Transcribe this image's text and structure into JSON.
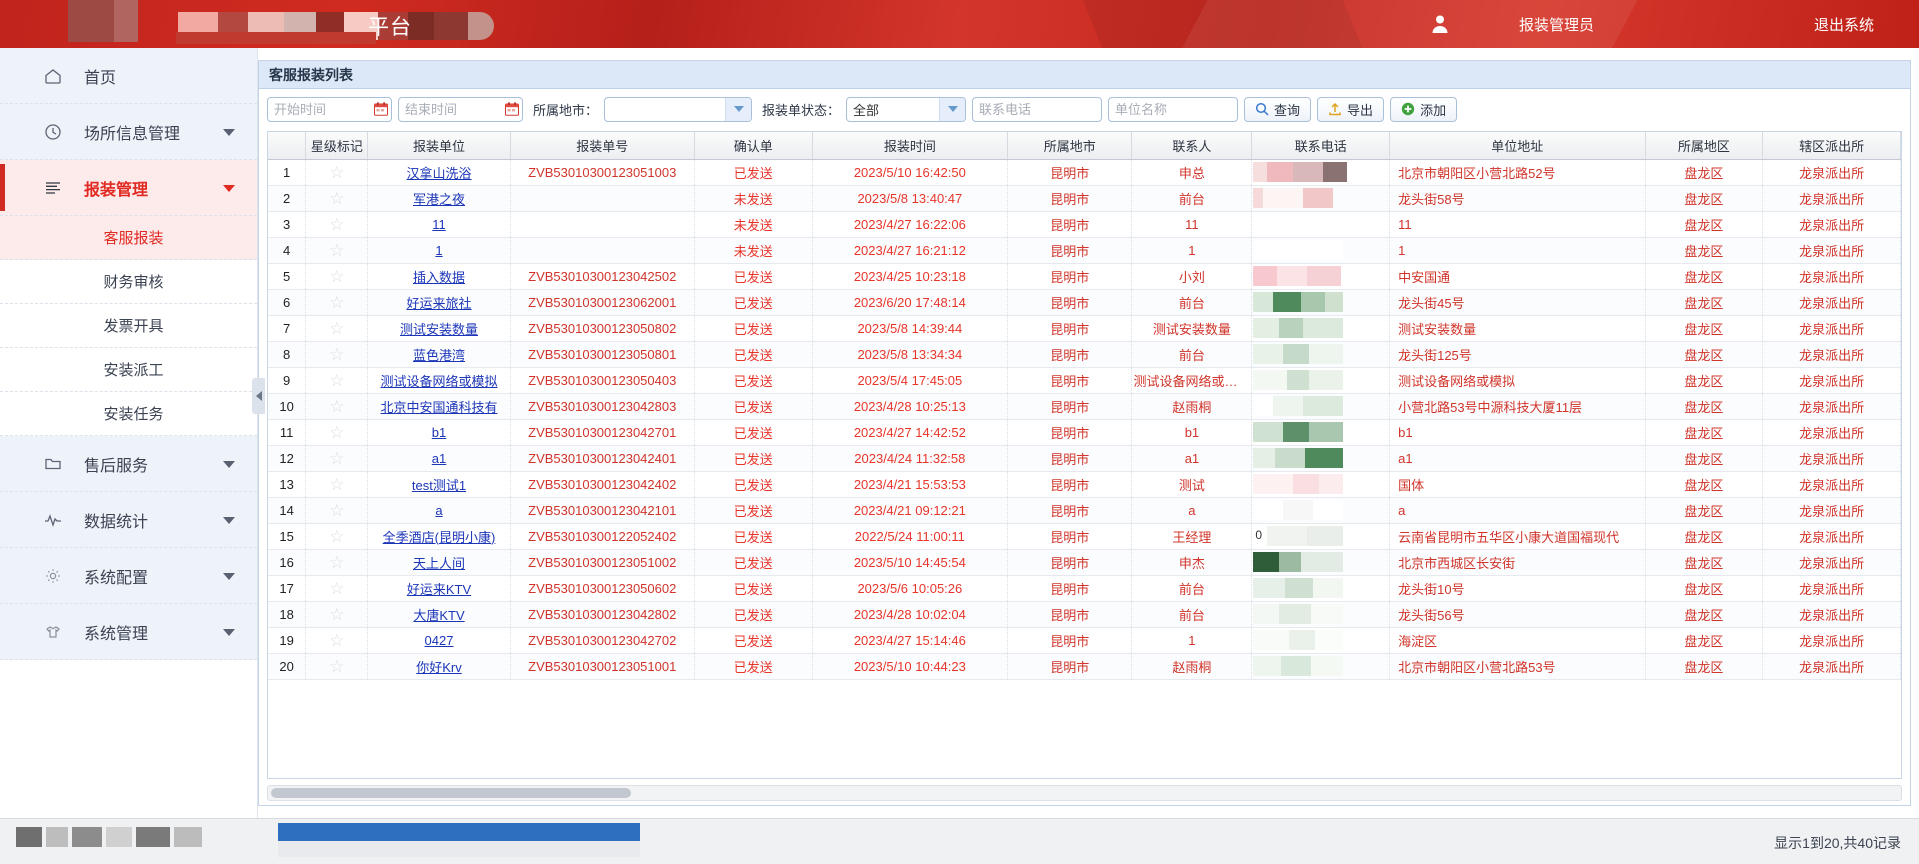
{
  "header": {
    "brand_suffix": "平台",
    "user_icon": "user-icon",
    "username": "报装管理员",
    "logout": "退出系统",
    "accent": "#c62820"
  },
  "sidebar": {
    "items": [
      {
        "label": "首页",
        "icon": "home-icon",
        "caret": false,
        "active": false
      },
      {
        "label": "场所信息管理",
        "icon": "clock-icon",
        "caret": true,
        "active": false
      },
      {
        "label": "报装管理",
        "icon": "list-icon",
        "caret": true,
        "active": true
      },
      {
        "label": "售后服务",
        "icon": "folder-icon",
        "caret": true,
        "active": false
      },
      {
        "label": "数据统计",
        "icon": "pulse-icon",
        "caret": true,
        "active": false
      },
      {
        "label": "系统配置",
        "icon": "gear-icon",
        "caret": true,
        "active": false
      },
      {
        "label": "系统管理",
        "icon": "shirt-icon",
        "caret": true,
        "active": false
      }
    ],
    "sub_items": [
      {
        "label": "客服报装",
        "active": true
      },
      {
        "label": "财务审核",
        "active": false
      },
      {
        "label": "发票开具",
        "active": false
      },
      {
        "label": "安装派工",
        "active": false
      },
      {
        "label": "安装任务",
        "active": false
      }
    ]
  },
  "panel": {
    "title": "客服报装列表"
  },
  "filters": {
    "start_time": {
      "value": "",
      "placeholder": "开始时间",
      "icon": "calendar-icon"
    },
    "end_time": {
      "value": "",
      "placeholder": "结束时间",
      "icon": "calendar-icon"
    },
    "city_label": "所属地市：",
    "city_value": "",
    "status_label": "报装单状态：",
    "status_value": "全部",
    "status_options": [
      "全部"
    ],
    "phone": {
      "value": "",
      "placeholder": "联系电话"
    },
    "unit": {
      "value": "",
      "placeholder": "单位名称"
    },
    "buttons": [
      {
        "label": "查询",
        "icon": "search-icon"
      },
      {
        "label": "导出",
        "icon": "export-icon"
      },
      {
        "label": "添加",
        "icon": "plus-icon"
      }
    ]
  },
  "table": {
    "columns": [
      "",
      "星级标记",
      "报装单位",
      "报装单号",
      "确认单",
      "报装时间",
      "所属地市",
      "联系人",
      "联系电话",
      "单位地址",
      "所属地区",
      "辖区派出所"
    ],
    "rows": [
      {
        "no": "1",
        "unit": "汉拿山洗浴",
        "order": "ZVB53010300123051003",
        "conf": "已发送",
        "time": "2023/5/10 16:42:50",
        "city": "昆明市",
        "contact": "申总",
        "phone": "",
        "addr": "北京市朝阳区小营北路52号",
        "area": "盘龙区",
        "police": "龙泉派出所"
      },
      {
        "no": "2",
        "unit": "军港之夜",
        "order": "",
        "conf": "未发送",
        "time": "2023/5/8 13:40:47",
        "city": "昆明市",
        "contact": "前台",
        "phone": "",
        "addr": "龙头街58号",
        "area": "盘龙区",
        "police": "龙泉派出所"
      },
      {
        "no": "3",
        "unit": "11",
        "order": "",
        "conf": "未发送",
        "time": "2023/4/27 16:22:06",
        "city": "昆明市",
        "contact": "11",
        "phone": "",
        "addr": "11",
        "area": "盘龙区",
        "police": "龙泉派出所"
      },
      {
        "no": "4",
        "unit": "1",
        "order": "",
        "conf": "未发送",
        "time": "2023/4/27 16:21:12",
        "city": "昆明市",
        "contact": "1",
        "phone": "",
        "addr": "1",
        "area": "盘龙区",
        "police": "龙泉派出所"
      },
      {
        "no": "5",
        "unit": "插入数据",
        "order": "ZVB53010300123042502",
        "conf": "已发送",
        "time": "2023/4/25 10:23:18",
        "city": "昆明市",
        "contact": "小刘",
        "phone": "",
        "addr": "中安国通",
        "area": "盘龙区",
        "police": "龙泉派出所"
      },
      {
        "no": "6",
        "unit": "好运来旅社",
        "order": "ZVB53010300123062001",
        "conf": "已发送",
        "time": "2023/6/20 17:48:14",
        "city": "昆明市",
        "contact": "前台",
        "phone": "",
        "addr": "龙头街45号",
        "area": "盘龙区",
        "police": "龙泉派出所"
      },
      {
        "no": "7",
        "unit": "测试安装数量",
        "order": "ZVB53010300123050802",
        "conf": "已发送",
        "time": "2023/5/8 14:39:44",
        "city": "昆明市",
        "contact": "测试安装数量",
        "phone": "",
        "addr": "测试安装数量",
        "area": "盘龙区",
        "police": "龙泉派出所"
      },
      {
        "no": "8",
        "unit": "蓝色港湾",
        "order": "ZVB53010300123050801",
        "conf": "已发送",
        "time": "2023/5/8 13:34:34",
        "city": "昆明市",
        "contact": "前台",
        "phone": "",
        "addr": "龙头街125号",
        "area": "盘龙区",
        "police": "龙泉派出所"
      },
      {
        "no": "9",
        "unit": "测试设备网络或模拟",
        "order": "ZVB53010300123050403",
        "conf": "已发送",
        "time": "2023/5/4 17:45:05",
        "city": "昆明市",
        "contact": "测试设备网络或模拟",
        "phone": "",
        "addr": "测试设备网络或模拟",
        "area": "盘龙区",
        "police": "龙泉派出所"
      },
      {
        "no": "10",
        "unit": "北京中安国通科技有",
        "order": "ZVB53010300123042803",
        "conf": "已发送",
        "time": "2023/4/28 10:25:13",
        "city": "昆明市",
        "contact": "赵雨桐",
        "phone": "",
        "addr": "小营北路53号中源科技大厦11层",
        "area": "盘龙区",
        "police": "龙泉派出所"
      },
      {
        "no": "11",
        "unit": "b1",
        "order": "ZVB53010300123042701",
        "conf": "已发送",
        "time": "2023/4/27 14:42:52",
        "city": "昆明市",
        "contact": "b1",
        "phone": "",
        "addr": "b1",
        "area": "盘龙区",
        "police": "龙泉派出所"
      },
      {
        "no": "12",
        "unit": "a1",
        "order": "ZVB53010300123042401",
        "conf": "已发送",
        "time": "2023/4/24 11:32:58",
        "city": "昆明市",
        "contact": "a1",
        "phone": "",
        "addr": "a1",
        "area": "盘龙区",
        "police": "龙泉派出所"
      },
      {
        "no": "13",
        "unit": "test测试1",
        "order": "ZVB53010300123042402",
        "conf": "已发送",
        "time": "2023/4/21 15:53:53",
        "city": "昆明市",
        "contact": "测试",
        "phone": "",
        "addr": "国体",
        "area": "盘龙区",
        "police": "龙泉派出所"
      },
      {
        "no": "14",
        "unit": "a",
        "order": "ZVB53010300123042101",
        "conf": "已发送",
        "time": "2023/4/21 09:12:21",
        "city": "昆明市",
        "contact": "a",
        "phone": "",
        "addr": "a",
        "area": "盘龙区",
        "police": "龙泉派出所"
      },
      {
        "no": "15",
        "unit": "全季酒店(昆明小康)",
        "order": "ZVB53010300122052402",
        "conf": "已发送",
        "time": "2022/5/24 11:00:11",
        "city": "昆明市",
        "contact": "王经理",
        "phone": "0",
        "addr": "云南省昆明市五华区小康大道国福现代",
        "area": "盘龙区",
        "police": "龙泉派出所"
      },
      {
        "no": "16",
        "unit": "天上人间",
        "order": "ZVB53010300123051002",
        "conf": "已发送",
        "time": "2023/5/10 14:45:54",
        "city": "昆明市",
        "contact": "申杰",
        "phone": "",
        "addr": "北京市西城区长安街",
        "area": "盘龙区",
        "police": "龙泉派出所"
      },
      {
        "no": "17",
        "unit": "好运来KTV",
        "order": "ZVB53010300123050602",
        "conf": "已发送",
        "time": "2023/5/6 10:05:26",
        "city": "昆明市",
        "contact": "前台",
        "phone": "",
        "addr": "龙头街10号",
        "area": "盘龙区",
        "police": "龙泉派出所"
      },
      {
        "no": "18",
        "unit": "大唐KTV",
        "order": "ZVB53010300123042802",
        "conf": "已发送",
        "time": "2023/4/28 10:02:04",
        "city": "昆明市",
        "contact": "前台",
        "phone": "",
        "addr": "龙头街56号",
        "area": "盘龙区",
        "police": "龙泉派出所"
      },
      {
        "no": "19",
        "unit": "0427",
        "order": "ZVB53010300123042702",
        "conf": "已发送",
        "time": "2023/4/27 15:14:46",
        "city": "昆明市",
        "contact": "1",
        "phone": "",
        "addr": "海淀区",
        "area": "盘龙区",
        "police": "龙泉派出所"
      },
      {
        "no": "20",
        "unit": "你好Krv",
        "order": "ZVB53010300123051001",
        "conf": "已发送",
        "time": "2023/5/10 10:44:23",
        "city": "昆明市",
        "contact": "赵雨桐",
        "phone": "",
        "addr": "北京市朝阳区小营北路53号",
        "area": "盘龙区",
        "police": "龙泉派出所"
      }
    ]
  },
  "footer": {
    "status": "显示1到20,共40记录"
  }
}
